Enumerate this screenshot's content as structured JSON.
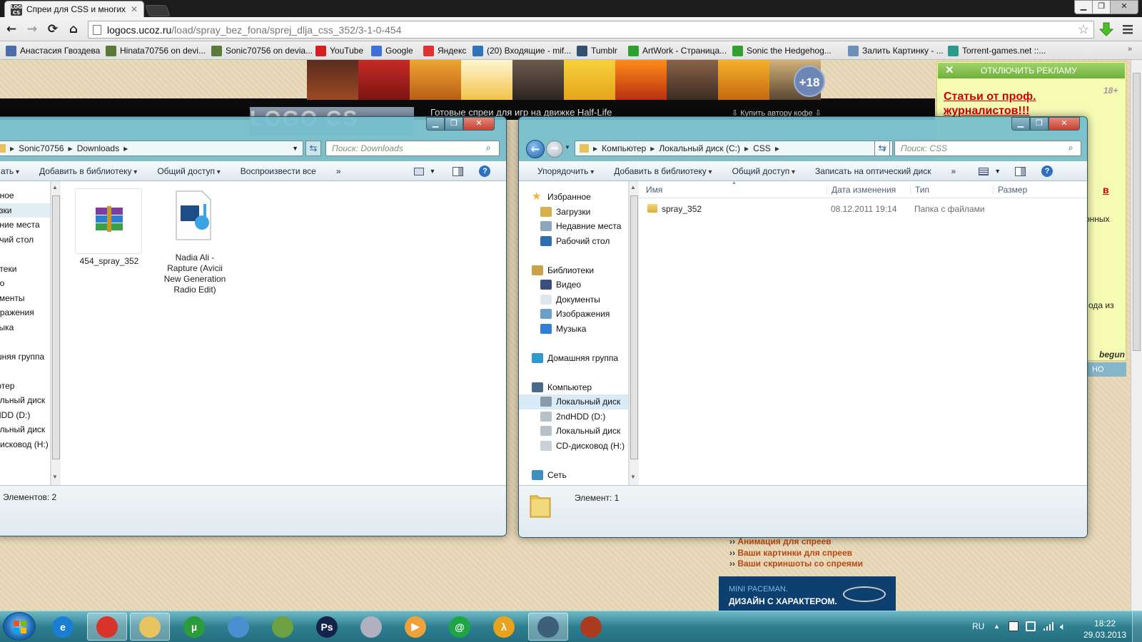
{
  "browser": {
    "tab_title": "Спреи для CSS и многих",
    "tab_favicon": "LOGO CS",
    "url_domain": "logocs.ucoz.ru",
    "url_path": "/load/spray_bez_fona/sprej_dlja_css_352/3-1-0-454",
    "bookmarks": [
      {
        "label": "Анастасия Гвоздева",
        "icon": "vk-icon",
        "color": "#4a6ea8"
      },
      {
        "label": "Hinata70756 on devi...",
        "icon": "deviantart-icon",
        "color": "#5a7a3a"
      },
      {
        "label": "Sonic70756 on devia...",
        "icon": "deviantart-icon",
        "color": "#5a7a3a"
      },
      {
        "label": "YouTube",
        "icon": "youtube-icon",
        "color": "#d61f1f"
      },
      {
        "label": "Google",
        "icon": "google-icon",
        "color": "#3f6fd8"
      },
      {
        "label": "Яндекс",
        "icon": "yandex-icon",
        "color": "#d33"
      },
      {
        "label": "(20) Входящие - mif...",
        "icon": "mail-icon",
        "color": "#2f73b8"
      },
      {
        "label": "Tumblr",
        "icon": "tumblr-icon",
        "color": "#34526f"
      },
      {
        "label": "ArtWork - Страница...",
        "icon": "gem-icon",
        "color": "#2fa12f"
      },
      {
        "label": "Sonic the Hedgehog...",
        "icon": "gem-icon",
        "color": "#2fa12f"
      },
      {
        "label": "Залить Картинку - ...",
        "icon": "image-host-icon",
        "color": "#6d8fb8"
      },
      {
        "label": "Torrent-games.net ::...",
        "icon": "torrent-icon",
        "color": "#2b9a8e"
      }
    ]
  },
  "site": {
    "badge": "+18",
    "logo": "LOGO CS",
    "header_caption": "Готовые спреи для игр на движке Half-Life",
    "coffee": "⇩ Купить автору кофе ⇩",
    "ad_off": "ОТКЛЮЧИТЬ РЕКЛАМУ",
    "ad_tag": "18+",
    "ad_link": "Статьи от проф. журналистов!!!",
    "ad_frag_1": "в",
    "ad_frag_2": "онных",
    "ad_frag_3": "ода из",
    "ad_sign": "begun",
    "ad_bar": "НО",
    "links": [
      {
        "prefix": "››",
        "label": "Анимация для спреев"
      },
      {
        "prefix": "››",
        "label": "Ваши картинки для спреев"
      },
      {
        "prefix": "››",
        "label": "Ваши скриншоты со спреями"
      }
    ],
    "mini_ad_1": "MINI PACEMAN.",
    "mini_ad_2": "ДИЗАЙН С ХАРАКТЕРОМ."
  },
  "downloads_window": {
    "breadcrumb": [
      "Sonic70756",
      "Downloads"
    ],
    "search_placeholder": "Поиск: Downloads",
    "commands": [
      "ать",
      "Добавить в библиотеку",
      "Общий доступ",
      "Воспроизвести все",
      "»"
    ],
    "nav": [
      "нное",
      "узки",
      "вние места",
      "очий стол",
      "",
      "отеки",
      "ео",
      "ументы",
      "бражения",
      "зыка",
      "",
      "шняя группа",
      "",
      "ютер",
      "альный диск",
      "HDD (D:)",
      "альный диск",
      "дисковод (H:)"
    ],
    "files": [
      {
        "name": "454_spray_352",
        "icon": "winrar-archive-icon"
      },
      {
        "name": "Nadia Ali - Rapture (Avicii New Generation Radio Edit)",
        "icon": "media-file-icon"
      }
    ],
    "status": "Элементов: 2"
  },
  "css_window": {
    "breadcrumb": [
      "Компьютер",
      "Локальный диск (C:)",
      "CSS"
    ],
    "search_placeholder": "Поиск: CSS",
    "commands": [
      "Упорядочить",
      "Добавить в библиотеку",
      "Общий доступ",
      "Записать на оптический диск",
      "»"
    ],
    "nav": [
      {
        "label": "Избранное",
        "icon": "star-icon",
        "level": 0
      },
      {
        "label": "Загрузки",
        "icon": "downloads-folder-icon",
        "level": 1
      },
      {
        "label": "Недавние места",
        "icon": "recent-places-icon",
        "level": 1
      },
      {
        "label": "Рабочий стол",
        "icon": "desktop-icon",
        "level": 1
      },
      {
        "label": "",
        "icon": "",
        "level": 0
      },
      {
        "label": "Библиотеки",
        "icon": "libraries-icon",
        "level": 0
      },
      {
        "label": "Видео",
        "icon": "video-library-icon",
        "level": 1
      },
      {
        "label": "Документы",
        "icon": "documents-library-icon",
        "level": 1
      },
      {
        "label": "Изображения",
        "icon": "pictures-library-icon",
        "level": 1
      },
      {
        "label": "Музыка",
        "icon": "music-library-icon",
        "level": 1
      },
      {
        "label": "",
        "icon": "",
        "level": 0
      },
      {
        "label": "Домашняя группа",
        "icon": "homegroup-icon",
        "level": 0
      },
      {
        "label": "",
        "icon": "",
        "level": 0
      },
      {
        "label": "Компьютер",
        "icon": "computer-icon",
        "level": 0
      },
      {
        "label": "Локальный диск",
        "icon": "system-drive-icon",
        "level": 1,
        "selected": true
      },
      {
        "label": "2ndHDD (D:)",
        "icon": "drive-icon",
        "level": 1
      },
      {
        "label": "Локальный диск",
        "icon": "drive-icon",
        "level": 1
      },
      {
        "label": "CD-дисковод (H:)",
        "icon": "cd-drive-icon",
        "level": 1
      },
      {
        "label": "",
        "icon": "",
        "level": 0
      },
      {
        "label": "Сеть",
        "icon": "network-icon",
        "level": 0
      }
    ],
    "columns": [
      "Имя",
      "Дата изменения",
      "Тип",
      "Размер"
    ],
    "rows": [
      {
        "name": "spray_352",
        "date": "08.12.2011 19:14",
        "type": "Папка с файлами",
        "size": ""
      }
    ],
    "status": "Элемент: 1"
  },
  "taskbar": {
    "apps": [
      {
        "name": "internet-explorer-icon",
        "glyph": "e",
        "color": "#1a7fd4",
        "active": false
      },
      {
        "name": "chrome-icon",
        "glyph": "",
        "color": "#d8342b",
        "active": true
      },
      {
        "name": "explorer-icon",
        "glyph": "",
        "color": "#e8c461",
        "active": true
      },
      {
        "name": "utorrent-icon",
        "glyph": "µ",
        "color": "#2a9d3a",
        "active": false
      },
      {
        "name": "paint-icon",
        "glyph": "",
        "color": "#4a8fd0",
        "active": false
      },
      {
        "name": "game-icon",
        "glyph": "",
        "color": "#6ca043",
        "active": false
      },
      {
        "name": "photoshop-icon",
        "glyph": "Ps",
        "color": "#13234a",
        "active": false
      },
      {
        "name": "dvd-icon",
        "glyph": "",
        "color": "#b0b0c0",
        "active": false
      },
      {
        "name": "media-player-icon",
        "glyph": "▶",
        "color": "#f1a13b",
        "active": false
      },
      {
        "name": "mail-agent-icon",
        "glyph": "@",
        "color": "#1fa446",
        "active": false
      },
      {
        "name": "half-life-icon",
        "glyph": "λ",
        "color": "#e9a21d",
        "active": false
      },
      {
        "name": "steam-icon",
        "glyph": "",
        "color": "#3d5f78",
        "active": true
      },
      {
        "name": "tf2-icon",
        "glyph": "",
        "color": "#a93b1e",
        "active": false
      }
    ],
    "lang": "RU",
    "time": "18:22",
    "date": "29.03.2013"
  }
}
